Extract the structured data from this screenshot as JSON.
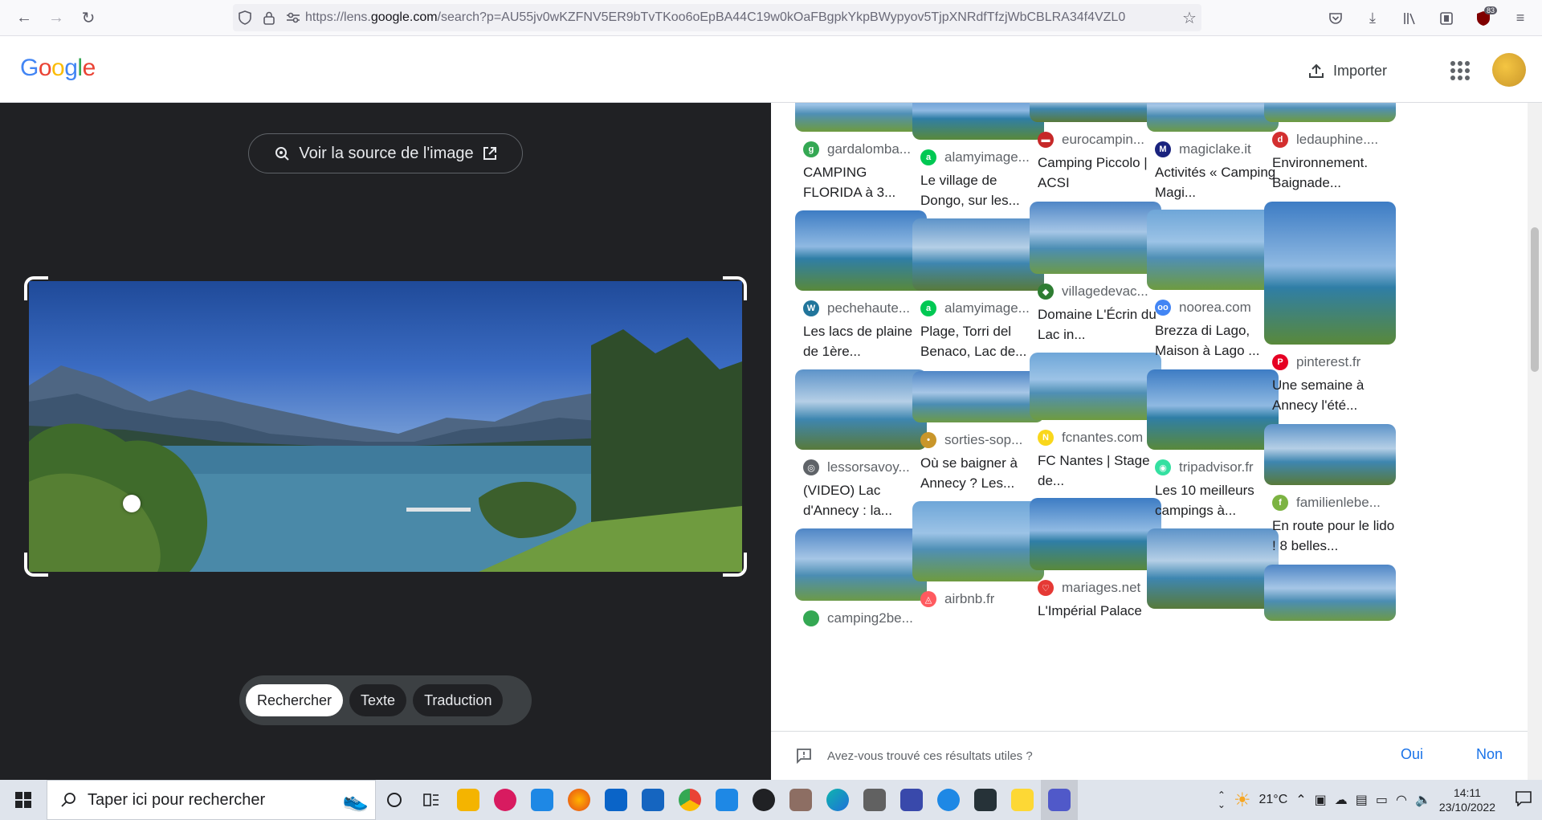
{
  "browser": {
    "url_prefix": "https://lens.",
    "url_domain": "google.com",
    "url_rest": "/search?p=AU55jv0wKZFNV5ER9bTvTKoo6oEpBA44C19w0kOaFBgpkYkpBWypyov5TjpXNRdfTfzjWbCBLRA34f4VZL0",
    "badge_count": "83"
  },
  "header": {
    "logo": "Google",
    "import_label": "Importer"
  },
  "lens": {
    "source_button": "Voir la source de l'image",
    "modes": [
      "Rechercher",
      "Texte",
      "Traduction"
    ]
  },
  "results": {
    "columns": [
      [
        {
          "source": "gardalomba...",
          "title": "CAMPING FLORIDA à 3...",
          "icon_color": "#34a853",
          "icon_char": "g"
        },
        {
          "source": "pechehaute...",
          "title": "Les lacs de plaine de 1ère...",
          "icon_color": "#21759b",
          "icon_char": "W"
        },
        {
          "source": "lessorsavoy...",
          "title": "(VIDEO) Lac d'Annecy : la...",
          "icon_color": "#5f6368",
          "icon_char": "◎"
        },
        {
          "source": "camping2be...",
          "title": "",
          "icon_color": "#34a853",
          "icon_char": ""
        }
      ],
      [
        {
          "source": "alamyimage...",
          "title": "Le village de Dongo, sur les...",
          "icon_color": "#00c853",
          "icon_char": "a"
        },
        {
          "source": "alamyimage...",
          "title": "Plage, Torri del Benaco, Lac de...",
          "icon_color": "#00c853",
          "icon_char": "a"
        },
        {
          "source": "sorties-sop...",
          "title": "Où se baigner à Annecy ? Les...",
          "icon_color": "#c9962a",
          "icon_char": "•"
        },
        {
          "source": "airbnb.fr",
          "title": "",
          "icon_color": "#ff5a5f",
          "icon_char": "◬"
        }
      ],
      [
        {
          "source": "eurocampin...",
          "title": "Camping Piccolo | ACSI",
          "icon_color": "#c62828",
          "icon_char": "▬"
        },
        {
          "source": "villagedevac...",
          "title": "Domaine L'Écrin du Lac in...",
          "icon_color": "#2e7d32",
          "icon_char": "◆"
        },
        {
          "source": "fcnantes.com",
          "title": "FC Nantes | Stage de...",
          "icon_color": "#f9d71c",
          "icon_char": "N"
        },
        {
          "source": "mariages.net",
          "title": "L'Impérial Palace",
          "icon_color": "#e53935",
          "icon_char": "♡"
        }
      ],
      [
        {
          "source": "magiclake.it",
          "title": "Activités « Camping Magi...",
          "icon_color": "#1a237e",
          "icon_char": "M"
        },
        {
          "source": "noorea.com",
          "title": "Brezza di Lago, Maison à Lago ...",
          "icon_color": "#4285f4",
          "icon_char": "oo"
        },
        {
          "source": "tripadvisor.fr",
          "title": "Les 10 meilleurs campings à...",
          "icon_color": "#34e0a1",
          "icon_char": "◉"
        },
        {
          "source": "",
          "title": "",
          "icon_color": "#ffffff",
          "icon_char": ""
        }
      ],
      [
        {
          "source": "ledauphine....",
          "title": "Environnement. Baignade...",
          "icon_color": "#d32f2f",
          "icon_char": "d"
        },
        {
          "source": "pinterest.fr",
          "title": "Une semaine à Annecy l'été...",
          "icon_color": "#e60023",
          "icon_char": "P"
        },
        {
          "source": "familienlebe...",
          "title": "En route pour le lido ! 8 belles...",
          "icon_color": "#7cb342",
          "icon_char": "f"
        },
        {
          "source": "",
          "title": "",
          "icon_color": "#ffffff",
          "icon_char": ""
        }
      ]
    ]
  },
  "feedback": {
    "question": "Avez-vous trouvé ces résultats utiles ?",
    "yes": "Oui",
    "no": "Non"
  },
  "taskbar": {
    "search_placeholder": "Taper ici pour rechercher",
    "weather": "21°C",
    "time": "14:11",
    "date": "23/10/2022"
  }
}
